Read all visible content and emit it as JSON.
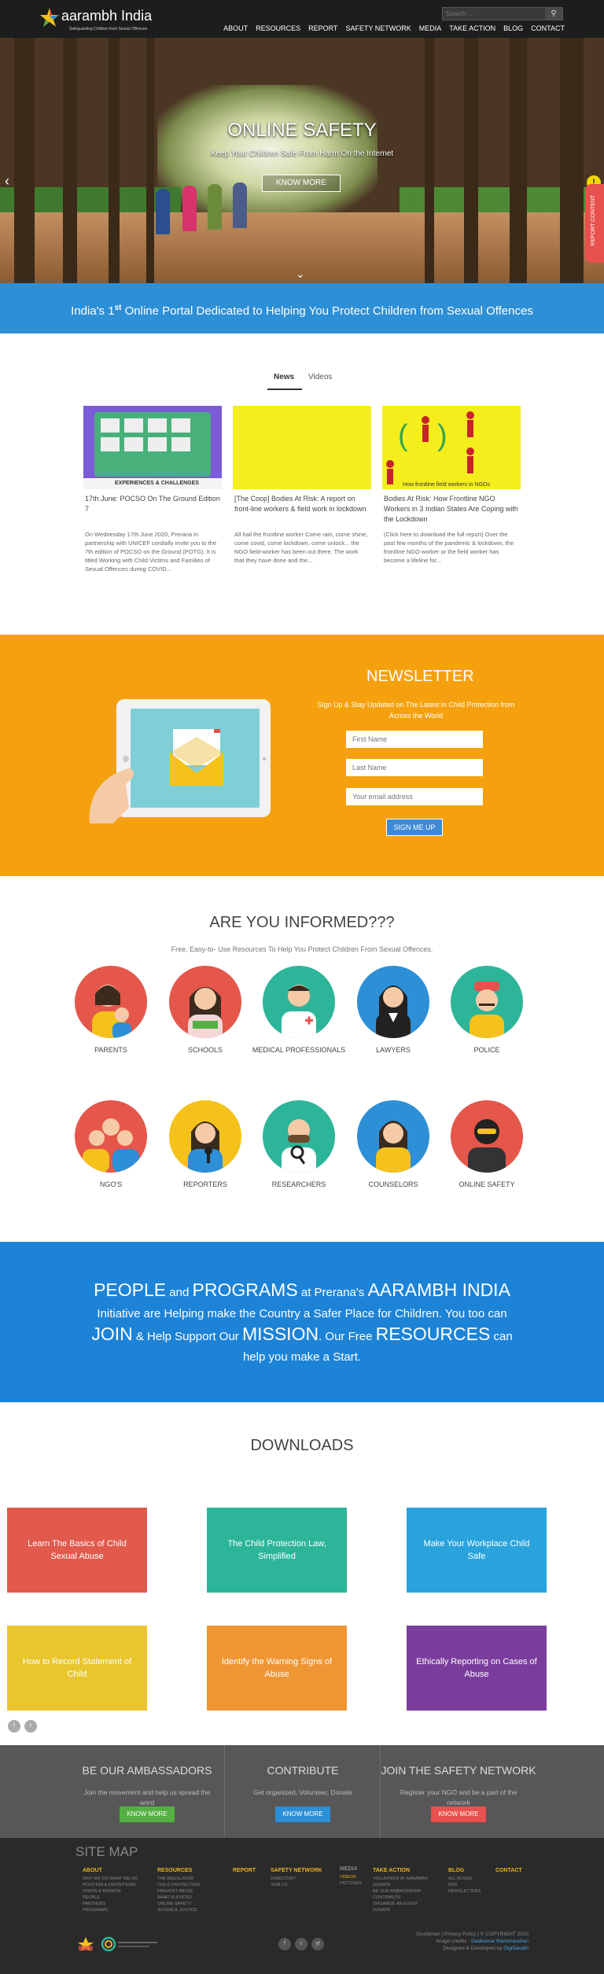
{
  "header": {
    "logo_name": "aarambh India",
    "logo_tagline": "Safeguarding Children from Sexual Offences",
    "search_placeholder": "Search ...",
    "nav": [
      "ABOUT",
      "RESOURCES",
      "REPORT",
      "SAFETY NETWORK",
      "MEDIA",
      "TAKE ACTION",
      "BLOG",
      "CONTACT"
    ]
  },
  "hero": {
    "title": "ONLINE SAFETY",
    "subtitle": "Keep Your Children Safe From Harm On the Internet",
    "button": "KNOW MORE",
    "report_tab": "REPORT CONTENT",
    "report_icon": "!"
  },
  "band": {
    "before": "India's 1",
    "sup": "st",
    "after": " Online Portal Dedicated to Helping You Protect Children from Sexual Offences"
  },
  "news": {
    "tabs": [
      "News",
      "Videos"
    ],
    "cards": [
      {
        "title": "17th June: POCSO On The Ground Edition 7",
        "body": "On Wednesday 17th June 2020, Prerana in partnership with UNICEF cordially invite you to the 7th edition of POCSO on the Ground (POTG). It is titled Working with Child Victims and Families of Sexual Offences during COVID..."
      },
      {
        "title": "[The Coop] Bodies At Risk: A report on front-line workers & field work in lockdown",
        "body": "All hail the frontline worker Come rain, come shine, come covid, come lockdown, come unlock... the NGO field-worker has been out there. The work that they have done and the..."
      },
      {
        "title": "Bodies At Risk: How Frontline NGO Workers in 3 Indian States Are Coping with the Lockdown",
        "body": "(Click here to download the full report) Over the past few months of the pandemic & lockdown, the frontline NGO worker or the field worker has become a lifeline for..."
      }
    ],
    "thumb_caption_1": "EXPERIENCES & CHALLENGES",
    "thumb_caption_3": "How frontline field workers in NGOs"
  },
  "newsletter": {
    "title": "NEWSLETTER",
    "subtitle": "Sign Up & Stay Updated on The Latest in Child Protection from Across the World",
    "first_name": "First Name",
    "last_name": "Last Name",
    "email": "Your email address",
    "button": "SIGN ME UP"
  },
  "informed": {
    "title": "ARE YOU INFORMED???",
    "subtitle": "Free, Easy-to- Use Resources To Help You Protect Children From Sexual Offences.",
    "items": [
      "PARENTS",
      "SCHOOLS",
      "MEDICAL PROFESSIONALS",
      "LAWYERS",
      "POLICE",
      "NGO'S",
      "REPORTERS",
      "RESEARCHERS",
      "COUNSELORS",
      "ONLINE SAFETY"
    ]
  },
  "people": {
    "l1a": "PEOPLE",
    "l1b": " and ",
    "l1c": "PROGRAMS",
    "l1d": " at Prerana's ",
    "l1e": "AARAMBH INDIA",
    "l2": "Initiative are Helping make the Country a Safer Place for Children. You too can",
    "l3a": "JOIN",
    "l3b": " & Help Support Our ",
    "l3c": "MISSION",
    "l3d": ". Our Free ",
    "l3e": "RESOURCES",
    "l3f": " can",
    "l4": "help you make a Start."
  },
  "downloads": {
    "title": "DOWNLOADS",
    "items": [
      "Learn The Basics of Child Sexual Abuse",
      "The Child Protection Law, Simplified",
      "Make Your Workplace Child Safe",
      "How to Record Statement of Child",
      "Identify the Warning Signs of Abuse",
      "Ethically Reporting on Cases of Abuse"
    ],
    "colors": [
      "#e15a4d",
      "#2db59a",
      "#2aa3dc",
      "#e9c62e",
      "#ef9634",
      "#7a3d9c"
    ],
    "social": [
      "f",
      "t"
    ]
  },
  "cta": [
    {
      "title": "BE OUR AMBASSADORS",
      "text": "Join the movement and help us spread the word",
      "button": "KNOW MORE",
      "color": "#55b043"
    },
    {
      "title": "CONTRIBUTE",
      "text": "Get organized, Volunteer, Donate",
      "button": "KNOW MORE",
      "color": "#2d8fd6"
    },
    {
      "title": "JOIN THE SAFETY NETWORK",
      "text": "Register your NGO and be a part of the network",
      "button": "KNOW MORE",
      "color": "#e8514d"
    }
  ],
  "footer": {
    "sitemap": "SITE MAP",
    "cols": [
      {
        "head": "ABOUT",
        "items": [
          "WHY WE DO WHAT WE DO",
          "POSITION & DEFINITIONS",
          "VISION & MISSION",
          "PEOPLE",
          "PARTNERS",
          "PROGRAMS"
        ]
      },
      {
        "head": "RESOURCES",
        "items": [
          "THE REGULATOR",
          "CHILD PROTECTION",
          "PREVENT ABUSE",
          "WHAT IS POCSO",
          "ONLINE SAFETY",
          "JUVENILE JUSTICE"
        ]
      },
      {
        "head": "REPORT",
        "items": []
      },
      {
        "head": "SAFETY NETWORK",
        "items": [
          "DIRECTORY",
          "JOIN US"
        ]
      },
      {
        "head": "MEDIA",
        "items": [
          "VIDEOS",
          "PICTURES"
        ]
      },
      {
        "head": "TAKE ACTION",
        "items": [
          "VOLUNTEER AT AARAMBH",
          "DONATE",
          "BE OUR AMBASSADOR",
          "CONTRIBUTE",
          "ORGANIZE AN EVENT",
          "DONATE"
        ]
      },
      {
        "head": "BLOG",
        "items": [
          "ALL BLOGS",
          "RSS",
          "NEWSLETTERS"
        ]
      },
      {
        "head": "CONTACT",
        "items": []
      }
    ],
    "social": [
      "f",
      "t",
      "yt"
    ],
    "right1": "Disclaimer | Privacy Policy | © COPYRIGHT 2020",
    "right2a": "Image credits : ",
    "right2b": "Sasikumar Ramchandran",
    "right3a": "Designed & Developed by ",
    "right3b": "DigiSarathi"
  }
}
